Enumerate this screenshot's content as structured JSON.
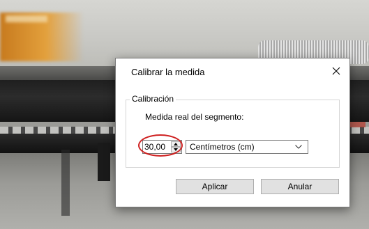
{
  "dialog": {
    "title": "Calibrar la medida",
    "group_title": "Calibración",
    "field_label": "Medida real del segmento:",
    "value": "30,00",
    "unit_selected": "Centímetros (cm)",
    "apply_label": "Aplicar",
    "cancel_label": "Anular"
  },
  "icons": {
    "close": "close-icon",
    "spin_up": "triangle-up-icon",
    "spin_down": "triangle-down-icon",
    "dropdown": "chevron-down-icon"
  },
  "colors": {
    "annotation": "#cf2222",
    "button_bg": "#e1e1e1",
    "dialog_bg": "#ffffff"
  }
}
